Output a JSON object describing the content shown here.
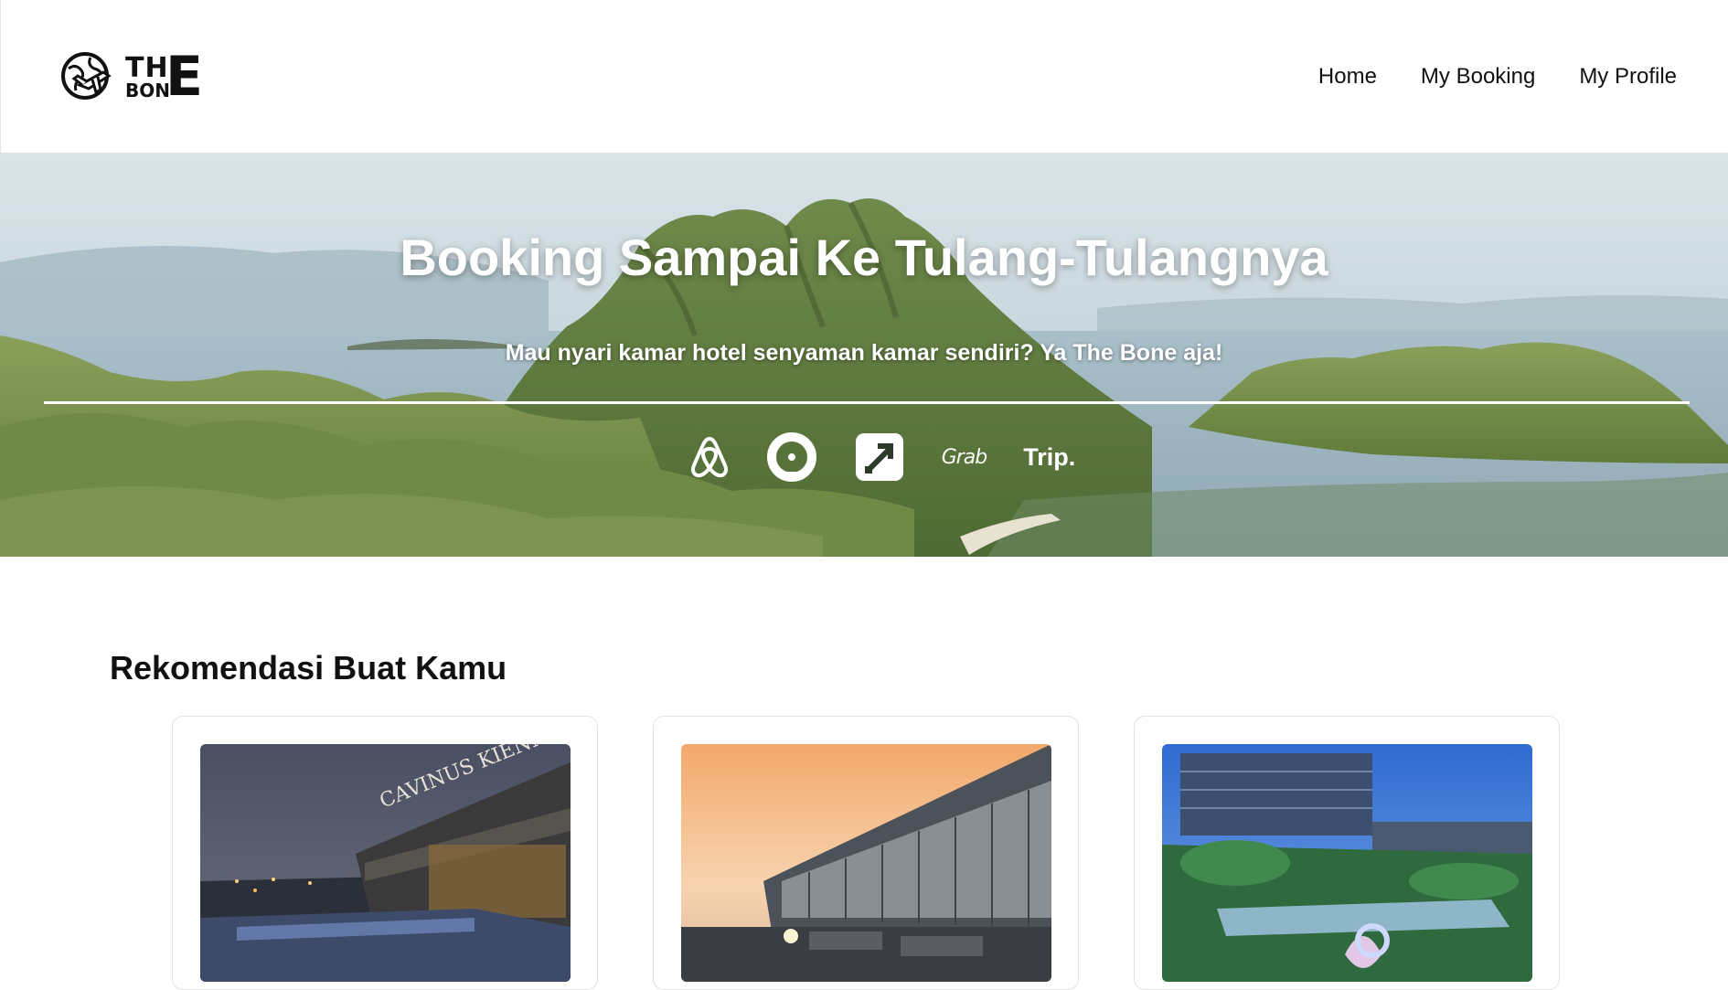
{
  "navbar": {
    "logo": {
      "line1": "TH",
      "line2": "BON",
      "big_letter": "E",
      "icon": "globe-airplane-icon"
    },
    "links": [
      {
        "label": "Home"
      },
      {
        "label": "My Booking"
      },
      {
        "label": "My Profile"
      }
    ]
  },
  "hero": {
    "title": "Booking Sampai Ke Tulang-Tulangnya",
    "subtitle": "Mau nyari kamar hotel senyaman kamar sendiri? Ya The Bone aja!",
    "partners": [
      {
        "name": "airbnb",
        "icon": "airbnb-icon"
      },
      {
        "name": "gojek",
        "icon": "gojek-icon"
      },
      {
        "name": "traveloka",
        "icon": "traveloka-icon"
      },
      {
        "name": "Grab",
        "icon": "grab-logo"
      },
      {
        "name": "Trip.",
        "icon": "trip-logo"
      }
    ]
  },
  "recommendations": {
    "title": "Rekomendasi Buat Kamu",
    "hotels": [
      {
        "image_sign": "CAVINUS KIENNE"
      },
      {
        "image_sign": ""
      },
      {
        "image_sign": ""
      }
    ]
  },
  "colors": {
    "text": "#111111",
    "hero_text": "#ffffff",
    "card_border": "#e3e3e3"
  }
}
